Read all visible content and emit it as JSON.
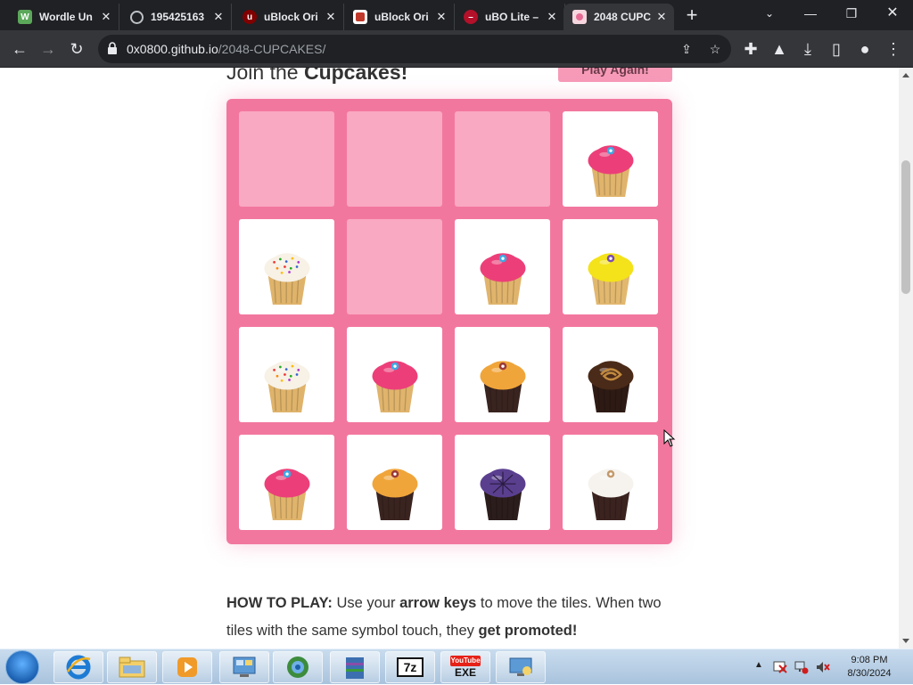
{
  "browser": {
    "tabs": [
      {
        "title": "Wordle Un",
        "favicon": "wordle-icon",
        "active": false
      },
      {
        "title": "195425163",
        "favicon": "globe-icon",
        "active": false
      },
      {
        "title": "uBlock Ori",
        "favicon": "ublock-icon",
        "active": false
      },
      {
        "title": "uBlock Ori",
        "favicon": "github-icon",
        "active": false
      },
      {
        "title": "uBO Lite –",
        "favicon": "ubo-lite-icon",
        "active": false
      },
      {
        "title": "2048 CUPC",
        "favicon": "cupcake-icon",
        "active": true
      }
    ],
    "address": {
      "host": "0x0800.github.io",
      "path": "/2048-CUPCAKES/"
    },
    "accent": "#35363a"
  },
  "page": {
    "heading_prefix": "Join the ",
    "heading_bold": "Cupcakes!",
    "play_again_label": "Play Again!",
    "board": [
      [
        null,
        null,
        null,
        "pink-frosted"
      ],
      [
        "sprinkle-vanilla",
        null,
        "pink-frosted",
        "yellow-frosted"
      ],
      [
        "sprinkle-vanilla",
        "pink-frosted",
        "caramel-chocolate",
        "chocolate-swirl"
      ],
      [
        "pink-frosted",
        "caramel-chocolate",
        "purple-web",
        "white-chocolate"
      ]
    ],
    "howto": {
      "label": "HOW TO PLAY:",
      "t1": " Use your ",
      "b1": "arrow keys",
      "t2": " to move the tiles. When two tiles with the same symbol touch, they ",
      "b2": "get promoted!"
    }
  },
  "taskbar": {
    "apps": [
      "internet-explorer-icon",
      "file-explorer-icon",
      "media-player-icon",
      "control-panel-icon",
      "browser-icon",
      "winrar-icon",
      "7zip-icon",
      "youtube-exe-icon",
      "remote-desktop-icon"
    ],
    "app_labels": {
      "7zip": "7z",
      "exe": "EXE",
      "yt": "YouTube"
    },
    "clock_time": "9:08 PM",
    "clock_date": "8/30/2024"
  }
}
